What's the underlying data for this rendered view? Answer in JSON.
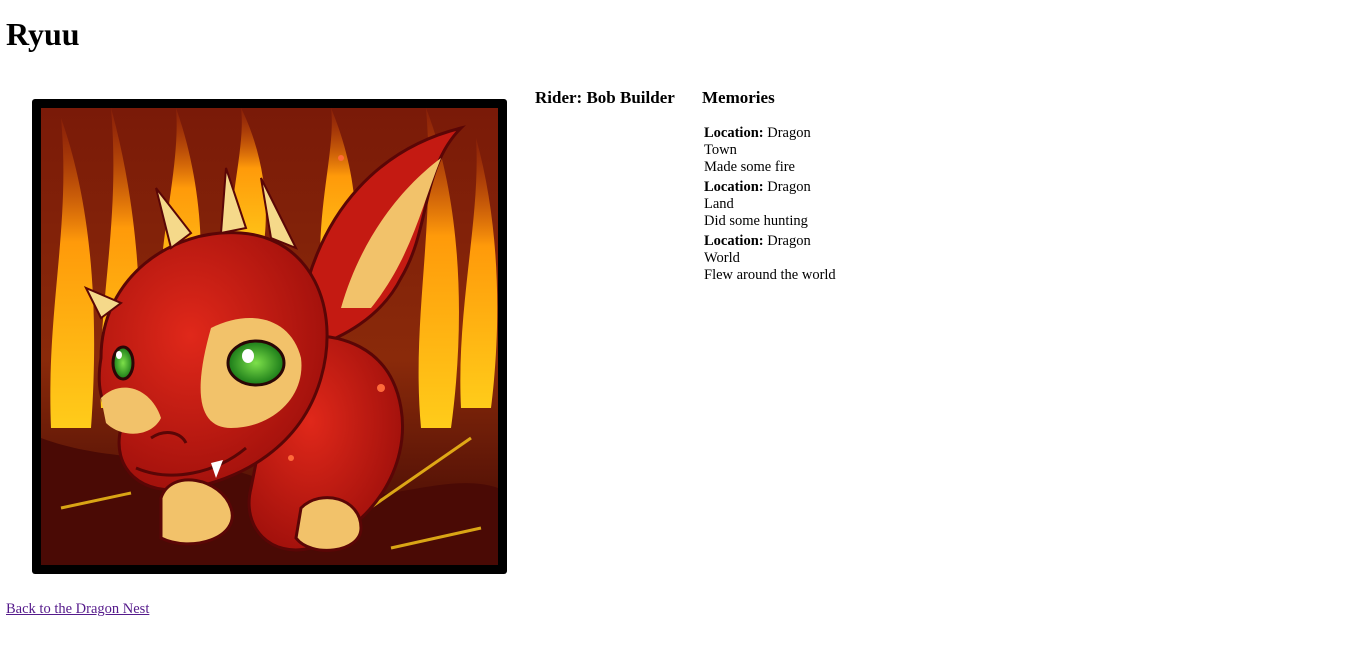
{
  "dragon": {
    "name": "Ryuu",
    "rider": "Rider: Bob Builder",
    "portrait_icon": "red-dragon-portrait"
  },
  "memories": {
    "heading": "Memories",
    "location_label": "Location:",
    "items": [
      {
        "location": "Dragon Town",
        "description": "Made some fire"
      },
      {
        "location": "Dragon Land",
        "description": "Did some hunting"
      },
      {
        "location": "Dragon World",
        "description": "Flew around the world"
      }
    ]
  },
  "nav": {
    "back_link": "Back to the Dragon Nest"
  },
  "colors": {
    "link_visited": "#551a8b",
    "frame": "#000000",
    "dragon_red": "#c41a12",
    "fire_yellow": "#ffd21e",
    "eye_green": "#2fa82a"
  }
}
